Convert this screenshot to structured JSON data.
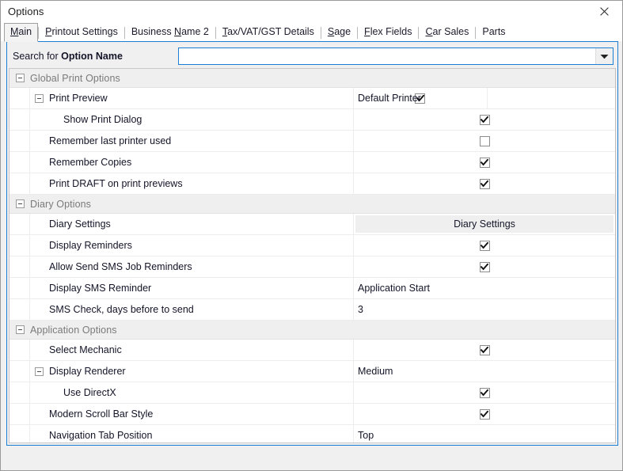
{
  "window": {
    "title": "Options",
    "close_icon": "close-icon"
  },
  "tabs": [
    {
      "label": "Main",
      "accel": "M",
      "selected": true
    },
    {
      "label": "Printout Settings",
      "accel": "P",
      "selected": false
    },
    {
      "label": "Business Name 2",
      "accel": "N",
      "selected": false
    },
    {
      "label": "Tax/VAT/GST Details",
      "accel": "T",
      "selected": false
    },
    {
      "label": "Sage",
      "accel": "S",
      "selected": false
    },
    {
      "label": "Flex Fields",
      "accel": "F",
      "selected": false
    },
    {
      "label": "Car Sales",
      "accel": "C",
      "selected": false
    },
    {
      "label": "Parts",
      "accel": "",
      "selected": false
    }
  ],
  "search": {
    "label_prefix": "Search for ",
    "label_bold": "Option Name",
    "value": "",
    "placeholder": "",
    "dropdown_icon": "chevron-down-icon"
  },
  "groups": [
    {
      "title": "Global Print Options",
      "expander": "collapse-minus-icon",
      "rows": [
        {
          "name": "Print Preview",
          "expander": true,
          "indent": 0,
          "value_type": "text",
          "value": "Default Printer",
          "split": true,
          "checked": true
        },
        {
          "name": "Show Print Dialog",
          "expander": false,
          "indent": 1,
          "value_type": "checkbox",
          "value": "",
          "split": false,
          "checked": true
        },
        {
          "name": "Remember last printer used",
          "expander": false,
          "indent": 0,
          "value_type": "checkbox",
          "value": "",
          "split": false,
          "checked": false
        },
        {
          "name": "Remember Copies",
          "expander": false,
          "indent": 0,
          "value_type": "checkbox",
          "value": "",
          "split": false,
          "checked": true
        },
        {
          "name": "Print DRAFT on print previews",
          "expander": false,
          "indent": 0,
          "value_type": "checkbox",
          "value": "",
          "split": false,
          "checked": true
        }
      ]
    },
    {
      "title": "Diary Options",
      "expander": "collapse-minus-icon",
      "rows": [
        {
          "name": "Diary Settings",
          "expander": false,
          "indent": 0,
          "value_type": "button",
          "value": "Diary Settings",
          "split": false,
          "checked": false
        },
        {
          "name": "Display Reminders",
          "expander": false,
          "indent": 0,
          "value_type": "checkbox",
          "value": "",
          "split": false,
          "checked": true
        },
        {
          "name": "Allow Send SMS Job Reminders",
          "expander": false,
          "indent": 0,
          "value_type": "checkbox",
          "value": "",
          "split": false,
          "checked": true
        },
        {
          "name": "Display SMS Reminder",
          "expander": false,
          "indent": 0,
          "value_type": "text",
          "value": "Application Start",
          "split": false,
          "checked": false
        },
        {
          "name": "SMS Check, days before to send",
          "expander": false,
          "indent": 0,
          "value_type": "text",
          "value": "3",
          "split": false,
          "checked": false
        }
      ]
    },
    {
      "title": "Application Options",
      "expander": "collapse-minus-icon",
      "rows": [
        {
          "name": "Select Mechanic",
          "expander": false,
          "indent": 0,
          "value_type": "checkbox",
          "value": "",
          "split": false,
          "checked": true
        },
        {
          "name": "Display Renderer",
          "expander": true,
          "indent": 0,
          "value_type": "text",
          "value": "Medium",
          "split": false,
          "checked": false
        },
        {
          "name": "Use DirectX",
          "expander": false,
          "indent": 1,
          "value_type": "checkbox",
          "value": "",
          "split": false,
          "checked": true
        },
        {
          "name": "Modern Scroll Bar Style",
          "expander": false,
          "indent": 0,
          "value_type": "checkbox",
          "value": "",
          "split": false,
          "checked": true
        },
        {
          "name": "Navigation Tab Position",
          "expander": false,
          "indent": 0,
          "value_type": "text",
          "value": "Top",
          "split": false,
          "checked": false
        }
      ]
    }
  ],
  "colors": {
    "accent": "#1a7fd4",
    "panel_bg": "#f0f0f0",
    "group_header_bg": "#efefef",
    "group_header_text": "#7a7a7a",
    "row_bg": "#ffffff"
  }
}
